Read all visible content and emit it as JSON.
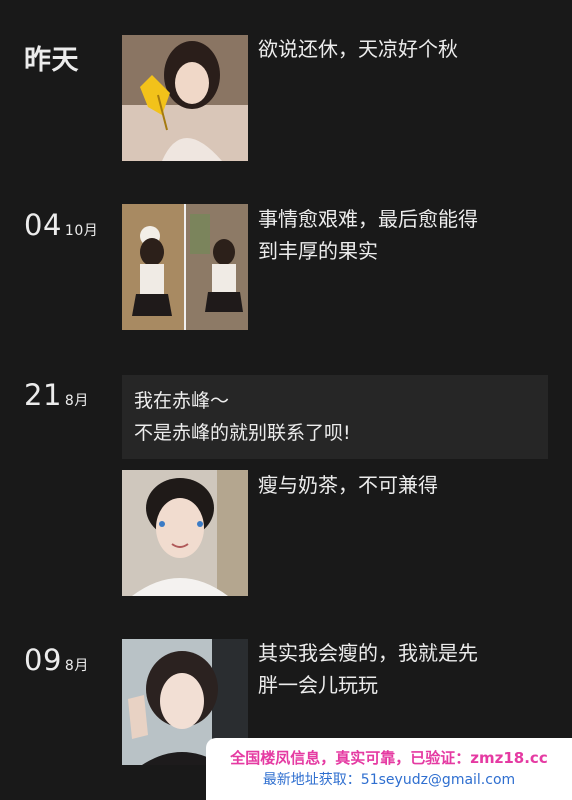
{
  "entries": [
    {
      "day": "昨天",
      "caption": "欲说还休，天凉好个秋"
    },
    {
      "day": "04",
      "month": "10月",
      "caption_lines": [
        "事情愈艰难，最后愈能得",
        "到丰厚的果实"
      ]
    },
    {
      "day": "21",
      "month": "8月",
      "text_lines": [
        "我在赤峰～",
        "不是赤峰的就别联系了呗!"
      ],
      "caption": "瘦与奶茶，不可兼得"
    },
    {
      "day": "09",
      "month": "8月",
      "caption_lines": [
        "其实我会瘦的，我就是先",
        "胖一会儿玩玩"
      ]
    }
  ],
  "banner": {
    "line1": "全国楼凤信息，真实可靠，已验证：zmz18.cc",
    "line2": "最新地址获取：51seyudz@gmail.com"
  }
}
